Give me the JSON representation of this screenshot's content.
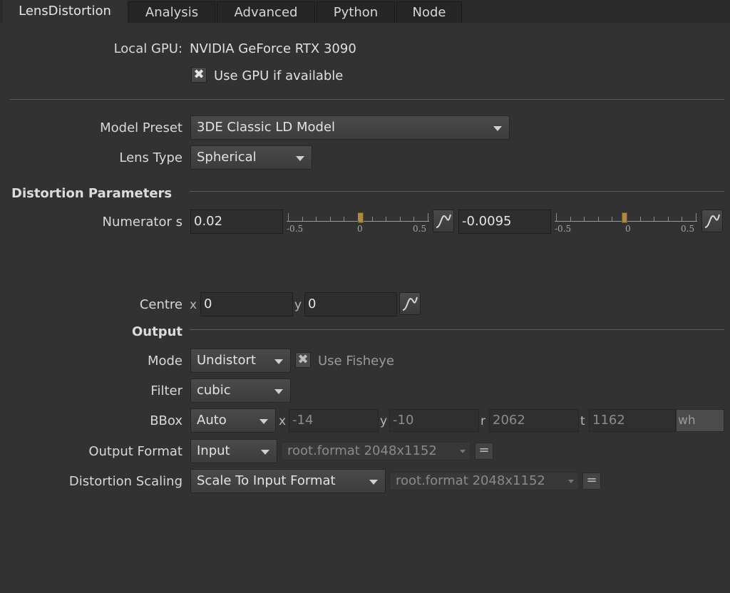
{
  "tabs": [
    {
      "label": "LensDistortion",
      "active": true
    },
    {
      "label": "Analysis"
    },
    {
      "label": "Advanced"
    },
    {
      "label": "Python"
    },
    {
      "label": "Node"
    }
  ],
  "gpu": {
    "label": "Local GPU:",
    "value": "NVIDIA GeForce RTX 3090",
    "use_gpu_label": "Use GPU if available",
    "use_gpu_checked": true,
    "check_glyph": "✖"
  },
  "model_preset": {
    "label": "Model Preset",
    "value": "3DE Classic LD Model"
  },
  "lens_type": {
    "label": "Lens Type",
    "value": "Spherical"
  },
  "distortion": {
    "section_title": "Distortion Parameters",
    "numerator_label": "Numerator s",
    "value1": "0.02",
    "value2": "-0.0095",
    "slider_min": "-0.5",
    "slider_mid": "0",
    "slider_max": "0.5",
    "slider1_fraction": 0.52,
    "slider2_fraction": 0.4905
  },
  "centre": {
    "label": "Centre",
    "x_label": "x",
    "x_value": "0",
    "y_label": "y",
    "y_value": "0"
  },
  "output": {
    "section_title": "Output",
    "mode_label": "Mode",
    "mode_value": "Undistort",
    "use_fisheye_label": "Use Fisheye",
    "use_fisheye_checked": true,
    "filter_label": "Filter",
    "filter_value": "cubic",
    "bbox_label": "BBox",
    "bbox_value": "Auto",
    "bbox_x_label": "x",
    "bbox_x": "-14",
    "bbox_y_label": "y",
    "bbox_y": "-10",
    "bbox_r_label": "r",
    "bbox_r": "2062",
    "bbox_t_label": "t",
    "bbox_t": "1162",
    "wh_label": "wh",
    "output_format_label": "Output Format",
    "output_format_value": "Input",
    "output_format_root": "root.format 2048x1152",
    "distortion_scaling_label": "Distortion Scaling",
    "distortion_scaling_value": "Scale To Input Format",
    "distortion_scaling_root": "root.format 2048x1152",
    "equals_label": "="
  },
  "icons": {
    "curve": "curve-icon",
    "dropdown": "chevron-down-icon",
    "check": "checkbox-x-icon"
  },
  "colors": {
    "background": "#323232",
    "slider_handle": "#b08a3a",
    "text": "#e0e0e0"
  }
}
